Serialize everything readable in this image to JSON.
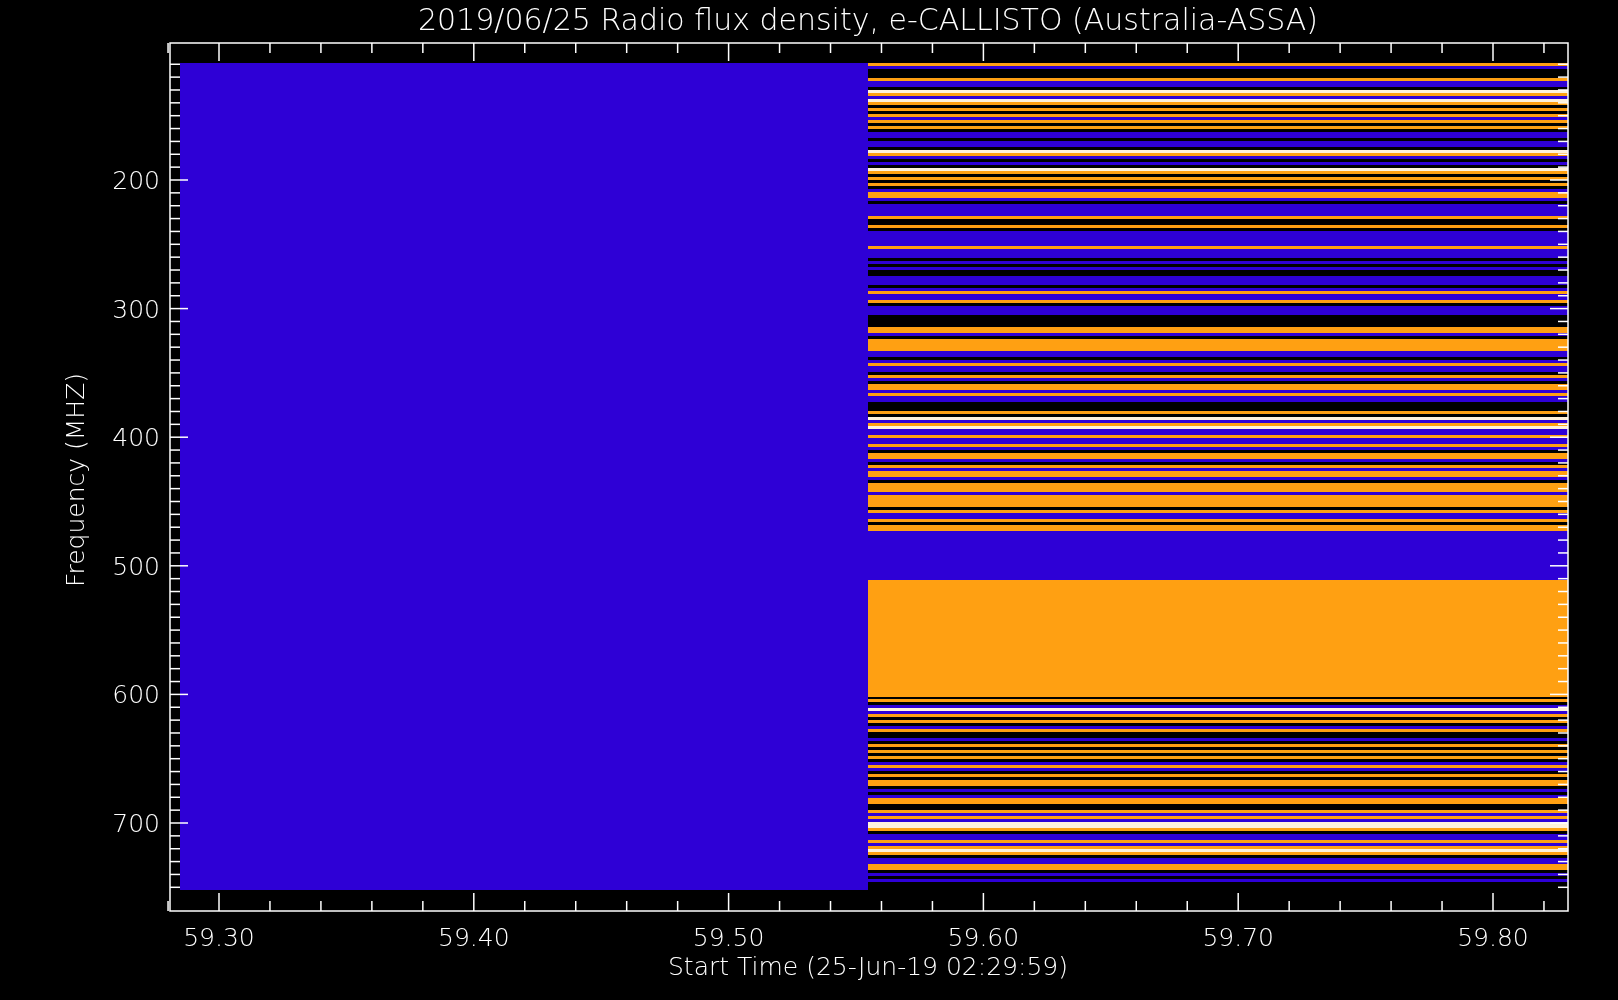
{
  "chart": {
    "title": "2019/06/25  Radio flux density, e-CALLISTO (Australia-ASSA)",
    "xlabel": "Start Time (25-Jun-19 02:29:59)",
    "ylabel": "Frequency (MHZ)",
    "xtick_labels": [
      "59.30",
      "59.40",
      "59.50",
      "59.60",
      "59.70",
      "59.80"
    ],
    "ytick_labels": [
      "200",
      "300",
      "400",
      "500",
      "600",
      "700"
    ]
  }
}
